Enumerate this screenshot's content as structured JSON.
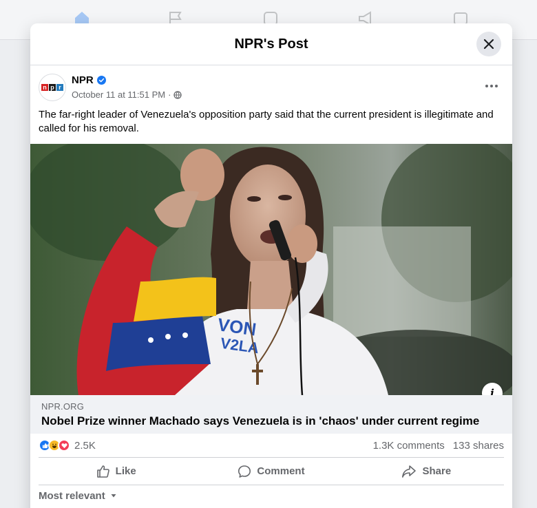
{
  "modal": {
    "title": "NPR's Post"
  },
  "post": {
    "page_name": "NPR",
    "verified": true,
    "timestamp": "October 11 at 11:51 PM",
    "separator": "·",
    "audience_icon": "globe-icon",
    "text": "The far-right leader of Venezuela's opposition party said that the current president is illegitimate and called for his removal.",
    "logo_letters": [
      "n",
      "p",
      "r"
    ],
    "logo_colors": [
      "#d62021",
      "#1a1a1a",
      "#237bbd"
    ]
  },
  "link": {
    "domain": "NPR.ORG",
    "title": "Nobel Prize winner Machado says Venezuela is in 'chaos' under current regime"
  },
  "stats": {
    "reactions": [
      "like-reaction-icon",
      "haha-reaction-icon",
      "love-reaction-icon"
    ],
    "reaction_count": "2.5K",
    "comments": "1.3K comments",
    "shares": "133 shares"
  },
  "actions": {
    "like": "Like",
    "comment": "Comment",
    "share": "Share"
  },
  "sort": {
    "label": "Most relevant"
  },
  "colors": {
    "brand_blue": "#1877f2",
    "text_secondary": "#65676b",
    "link_bg": "#f0f2f5"
  }
}
